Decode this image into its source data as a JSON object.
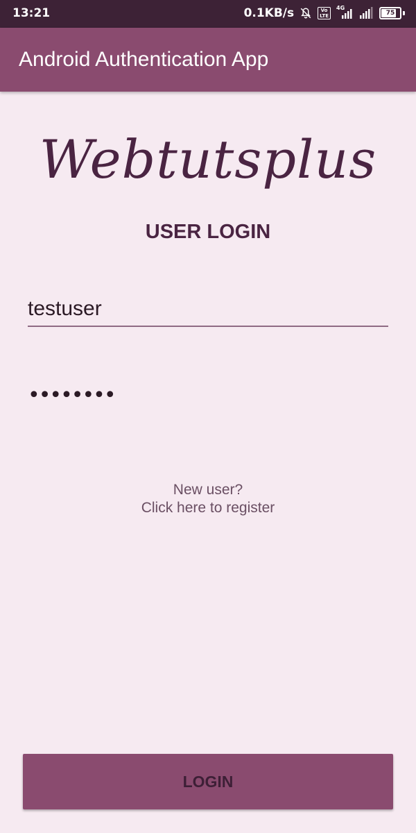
{
  "status_bar": {
    "time": "13:21",
    "net_speed": "0.1KB/s",
    "volte": "Vo\nLTE",
    "network_type": "4G",
    "battery_level": "75",
    "icons": [
      "bell-muted-icon",
      "volte-icon",
      "signal-4g-icon",
      "signal-icon",
      "battery-icon"
    ]
  },
  "app_bar": {
    "title": "Android Authentication App"
  },
  "login": {
    "brand": "Webtutsplus",
    "heading": "USER LOGIN",
    "username_value": "testuser",
    "password_value": "••••••••",
    "register_line1": "New user?",
    "register_line2": "Click here to register",
    "login_button": "LOGIN"
  },
  "colors": {
    "status_bar": "#3d2236",
    "app_bar": "#8a4b6f",
    "background": "#f6eaf1",
    "accent_text": "#4a2442"
  }
}
